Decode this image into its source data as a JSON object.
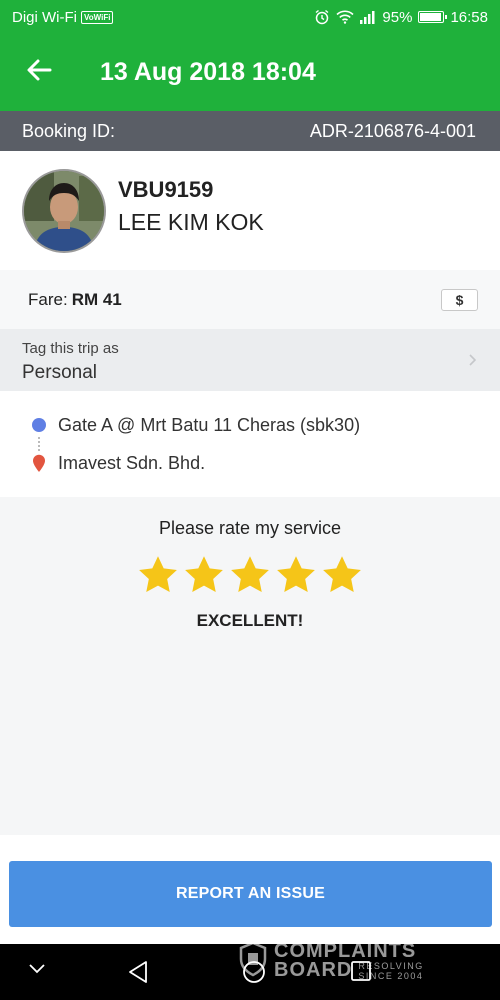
{
  "status_bar": {
    "carrier": "Digi Wi-Fi",
    "volte_badge": "VoWiFi",
    "battery": "95%",
    "battery_level": 0.95,
    "time": "16:58",
    "icons": [
      "alarm-icon",
      "wifi-icon",
      "signal-icon",
      "battery-icon"
    ]
  },
  "header": {
    "title": "13 Aug 2018 18:04",
    "back_icon": "arrow-left-icon"
  },
  "booking": {
    "label": "Booking ID:",
    "id": "ADR-2106876-4-001"
  },
  "driver": {
    "plate": "VBU9159",
    "name": "LEE KIM KOK"
  },
  "fare": {
    "label": "Fare:",
    "value": "RM 41",
    "payment_icon": "$"
  },
  "tag": {
    "label": "Tag this trip as",
    "value": "Personal"
  },
  "route": {
    "pickup": "Gate A @ Mrt Batu 11 Cheras (sbk30)",
    "dropoff": "Imavest Sdn. Bhd."
  },
  "rating": {
    "prompt": "Please rate my service",
    "stars": 5,
    "max_stars": 5,
    "result": "EXCELLENT!"
  },
  "actions": {
    "report_label": "REPORT AN ISSUE"
  },
  "watermark": {
    "line1": "COMPLAINTS",
    "line2": "BOARD",
    "sub1": "RESOLVING",
    "sub2": "SINCE 2004"
  },
  "colors": {
    "brand_green": "#1fb13b",
    "booking_bar": "#5a5e66",
    "star": "#f5c518",
    "report_button": "#4a90e2",
    "pickup_dot": "#5f7fe4",
    "dropoff_pin": "#e2553f"
  }
}
